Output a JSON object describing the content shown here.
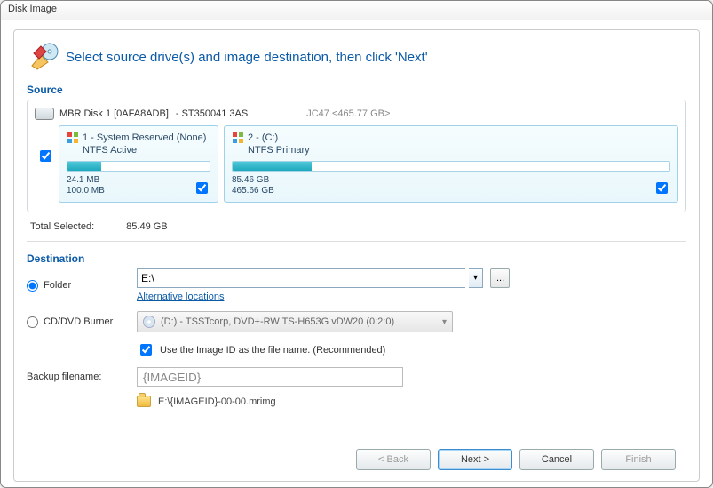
{
  "window": {
    "title": "Disk Image"
  },
  "header": {
    "title": "Select source drive(s) and image destination, then click 'Next'"
  },
  "source": {
    "title": "Source",
    "disk": {
      "label": "MBR Disk 1 [0AFA8ADB]",
      "model": "- ST350041 3AS",
      "extra": "JC47  <465.77 GB>"
    },
    "partitions": [
      {
        "title": "1 - System Reserved (None)",
        "sub": "NTFS Active",
        "used": "24.1 MB",
        "total": "100.0 MB",
        "fill_pct": 24
      },
      {
        "title": "2 -  (C:)",
        "sub": "NTFS Primary",
        "used": "85.46 GB",
        "total": "465.66 GB",
        "fill_pct": 18
      }
    ],
    "total_label": "Total Selected:",
    "total_value": "85.49 GB"
  },
  "destination": {
    "title": "Destination",
    "folder_label": "Folder",
    "folder_value": "E:\\",
    "alt_link": "Alternative locations",
    "burner_label": "CD/DVD Burner",
    "burner_value": "(D:) - TSSTcorp, DVD+-RW TS-H653G vDW20 (0:2:0)",
    "use_imageid_label": "Use the Image ID as the file name.  (Recommended)",
    "filename_label": "Backup filename:",
    "filename_value": "{IMAGEID}",
    "path_value": "E:\\{IMAGEID}-00-00.mrimg"
  },
  "buttons": {
    "back": "< Back",
    "next": "Next >",
    "cancel": "Cancel",
    "finish": "Finish"
  }
}
